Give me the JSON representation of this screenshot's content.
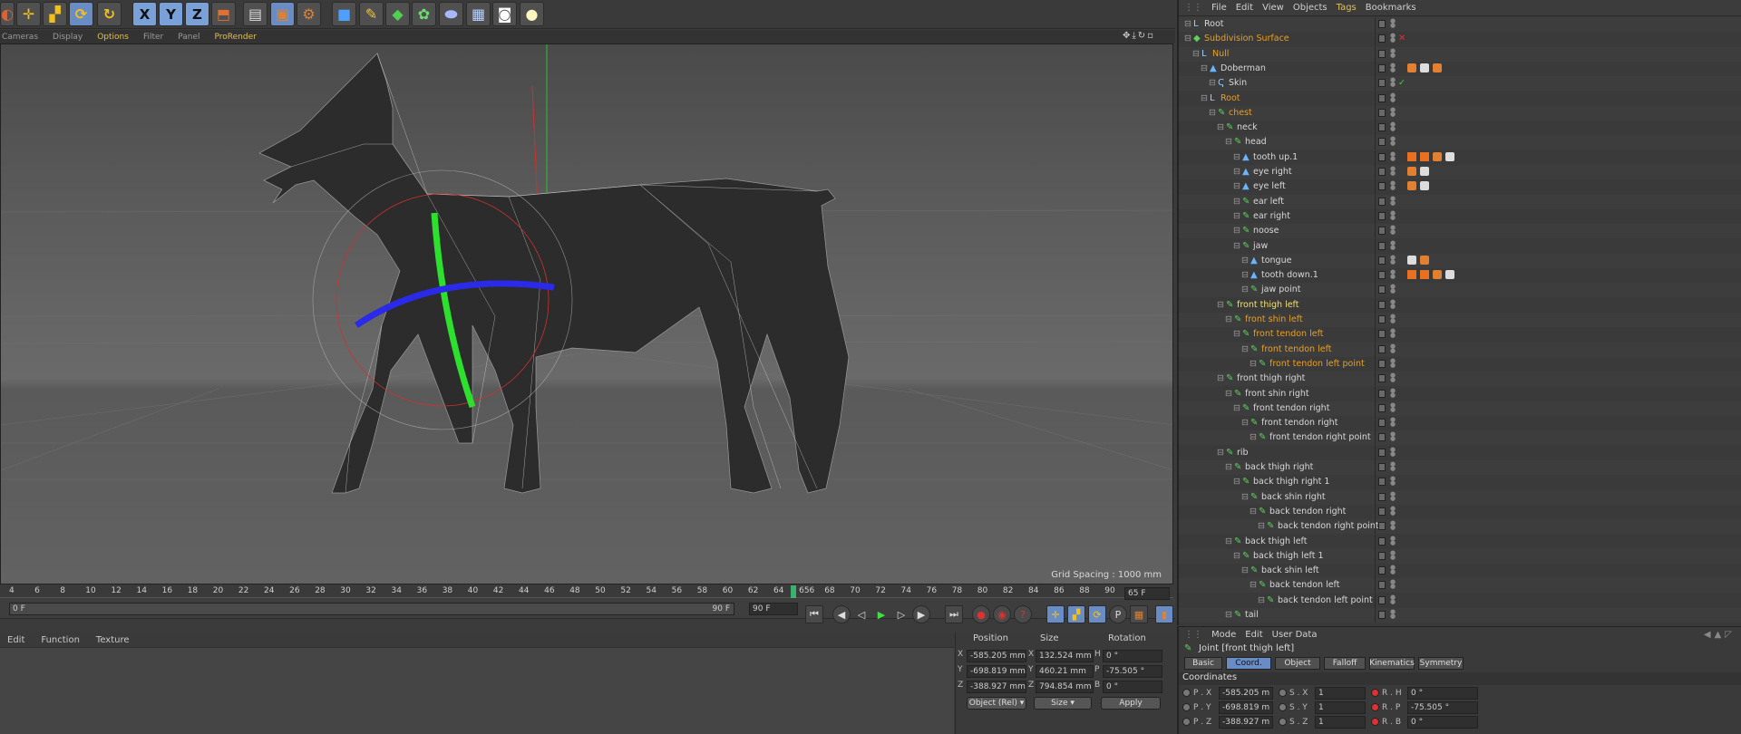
{
  "toolbar": {
    "axes": [
      "X",
      "Y",
      "Z"
    ],
    "icons": [
      "move-icon",
      "scale-icon",
      "rotate-icon",
      "rotate-icon",
      "render-icon",
      "render-view-icon",
      "render-settings-icon",
      "cube-icon",
      "pen-icon",
      "subdivision-icon",
      "deformer-icon",
      "floor-icon",
      "camera-icon",
      "light-icon"
    ]
  },
  "viewport": {
    "menu": [
      "Cameras",
      "Display",
      "Options",
      "Filter",
      "Panel",
      "ProRender"
    ],
    "active_menu": "Options",
    "grid_spacing": "Grid Spacing : 1000 mm"
  },
  "timeline": {
    "ticks": [
      "4",
      "6",
      "8",
      "10",
      "12",
      "14",
      "16",
      "18",
      "20",
      "22",
      "24",
      "26",
      "28",
      "30",
      "32",
      "34",
      "36",
      "38",
      "40",
      "42",
      "44",
      "46",
      "48",
      "50",
      "52",
      "54",
      "56",
      "58",
      "60",
      "62",
      "64",
      "656",
      "68",
      "70",
      "72",
      "74",
      "76",
      "78",
      "80",
      "82",
      "84",
      "86",
      "88",
      "90"
    ],
    "current_frame": "65 F",
    "start": "0 F",
    "end_label": "90 F",
    "end_field": "90 F"
  },
  "material_menu": [
    "Edit",
    "Function",
    "Texture"
  ],
  "coordinates": {
    "headers": [
      "Position",
      "Size",
      "Rotation"
    ],
    "rows": [
      {
        "axis": "X",
        "pos": "-585.205 mm",
        "size_axis": "X",
        "size": "132.524 mm",
        "rot_axis": "H",
        "rot": "0 °"
      },
      {
        "axis": "Y",
        "pos": "-698.819 mm",
        "size_axis": "Y",
        "size": "460.21 mm",
        "rot_axis": "P",
        "rot": "-75.505 °"
      },
      {
        "axis": "Z",
        "pos": "-388.927 mm",
        "size_axis": "Z",
        "size": "794.854 mm",
        "rot_axis": "B",
        "rot": "0 °"
      }
    ],
    "mode_select": "Object (Rel)",
    "size_select": "Size",
    "apply": "Apply"
  },
  "object_manager": {
    "menu": [
      "File",
      "Edit",
      "View",
      "Objects",
      "Tags",
      "Bookmarks"
    ],
    "active_menu": "Tags",
    "items": [
      {
        "label": "Root",
        "depth": 0,
        "color": "normal"
      },
      {
        "label": "Subdivision Surface",
        "depth": 0,
        "color": "orange"
      },
      {
        "label": "Null",
        "depth": 1,
        "color": "orange"
      },
      {
        "label": "Doberman",
        "depth": 2,
        "color": "normal"
      },
      {
        "label": "Skin",
        "depth": 3,
        "color": "normal"
      },
      {
        "label": "Root",
        "depth": 2,
        "color": "orange"
      },
      {
        "label": "chest",
        "depth": 3,
        "color": "orange"
      },
      {
        "label": "neck",
        "depth": 4,
        "color": "normal"
      },
      {
        "label": "head",
        "depth": 5,
        "color": "normal"
      },
      {
        "label": "tooth up.1",
        "depth": 6,
        "color": "normal"
      },
      {
        "label": "eye right",
        "depth": 6,
        "color": "normal"
      },
      {
        "label": "eye left",
        "depth": 6,
        "color": "normal"
      },
      {
        "label": "ear left",
        "depth": 6,
        "color": "normal"
      },
      {
        "label": "ear right",
        "depth": 6,
        "color": "normal"
      },
      {
        "label": "noose",
        "depth": 6,
        "color": "normal"
      },
      {
        "label": "jaw",
        "depth": 6,
        "color": "normal"
      },
      {
        "label": "tongue",
        "depth": 7,
        "color": "normal"
      },
      {
        "label": "tooth down.1",
        "depth": 7,
        "color": "normal"
      },
      {
        "label": "jaw point",
        "depth": 7,
        "color": "normal"
      },
      {
        "label": "front thigh left",
        "depth": 4,
        "color": "yellow"
      },
      {
        "label": "front shin left",
        "depth": 5,
        "color": "orange"
      },
      {
        "label": "front tendon left",
        "depth": 6,
        "color": "orange"
      },
      {
        "label": "front tendon left",
        "depth": 7,
        "color": "orange"
      },
      {
        "label": "front tendon left point",
        "depth": 8,
        "color": "orange"
      },
      {
        "label": "front thigh right",
        "depth": 4,
        "color": "normal"
      },
      {
        "label": "front shin right",
        "depth": 5,
        "color": "normal"
      },
      {
        "label": "front tendon right",
        "depth": 6,
        "color": "normal"
      },
      {
        "label": "front tendon right",
        "depth": 7,
        "color": "normal"
      },
      {
        "label": "front tendon right point",
        "depth": 8,
        "color": "normal"
      },
      {
        "label": "rib",
        "depth": 4,
        "color": "normal"
      },
      {
        "label": "back thigh right",
        "depth": 5,
        "color": "normal"
      },
      {
        "label": "back thigh right 1",
        "depth": 6,
        "color": "normal"
      },
      {
        "label": "back shin right",
        "depth": 7,
        "color": "normal"
      },
      {
        "label": "back tendon right",
        "depth": 8,
        "color": "normal"
      },
      {
        "label": "back tendon right point",
        "depth": 9,
        "color": "normal"
      },
      {
        "label": "back thigh left",
        "depth": 5,
        "color": "normal"
      },
      {
        "label": "back thigh left 1",
        "depth": 6,
        "color": "normal"
      },
      {
        "label": "back shin left",
        "depth": 7,
        "color": "normal"
      },
      {
        "label": "back tendon left",
        "depth": 8,
        "color": "normal"
      },
      {
        "label": "back tendon left point",
        "depth": 9,
        "color": "normal"
      },
      {
        "label": "tail",
        "depth": 5,
        "color": "normal"
      }
    ]
  },
  "attributes": {
    "menu": [
      "Mode",
      "Edit",
      "User Data"
    ],
    "title": "Joint [front thigh left]",
    "tabs": [
      "Basic",
      "Coord.",
      "Object",
      "Falloff",
      "Kinematics",
      "Symmetry"
    ],
    "active_tab": "Coord.",
    "section": "Coordinates",
    "rows": [
      {
        "p": "P . X",
        "pv": "-585.205 m",
        "s": "S . X",
        "sv": "1",
        "r": "R . H",
        "rv": "0 °"
      },
      {
        "p": "P . Y",
        "pv": "-698.819 m",
        "s": "S . Y",
        "sv": "1",
        "r": "R . P",
        "rv": "-75.505 °"
      },
      {
        "p": "P . Z",
        "pv": "-388.927 m",
        "s": "S . Z",
        "sv": "1",
        "r": "R . B",
        "rv": "0 °"
      }
    ]
  }
}
